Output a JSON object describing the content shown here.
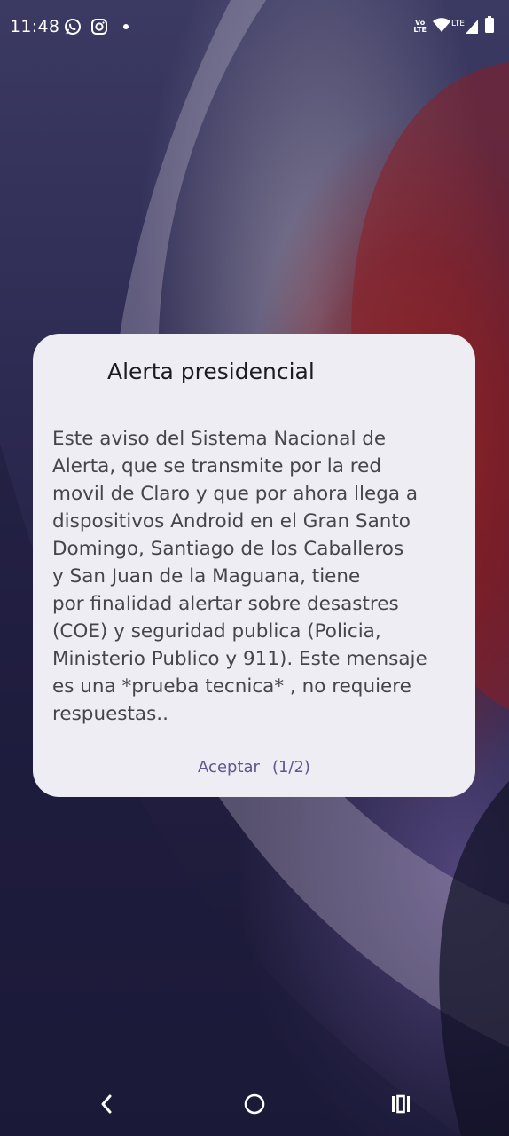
{
  "status_bar": {
    "time": "11:48",
    "left_icons": [
      "whatsapp-icon",
      "instagram-icon",
      "notification-dot-icon"
    ],
    "volte_top": "Vo",
    "volte_bottom": "LTE",
    "network_label": "LTE",
    "right_icons": [
      "volte-icon",
      "wifi-icon",
      "lte-signal-icon",
      "battery-icon"
    ]
  },
  "dialog": {
    "title": "Alerta presidencial",
    "body": "Este aviso del Sistema Nacional de\nAlerta, que se transmite por la red\nmovil de Claro y que por ahora llega a\ndispositivos Android en el Gran Santo\nDomingo, Santiago de los Caballeros\ny San Juan de la Maguana, tiene\npor finalidad alertar sobre desastres\n(COE) y seguridad publica (Policia,\nMinisterio Publico y 911). Este mensaje\nes una *prueba tecnica* , no requiere\nrespuestas..",
    "accept_label": "Aceptar",
    "page_indicator": "(1/2)"
  },
  "nav_bar": {
    "icons": [
      "back-icon",
      "home-icon",
      "recents-icon"
    ]
  },
  "colors": {
    "dialog_bg": "#efedf4",
    "title_text": "#1c1b1f",
    "body_text": "#46444c",
    "accent": "#5b588d",
    "status_text": "#ffffff"
  }
}
